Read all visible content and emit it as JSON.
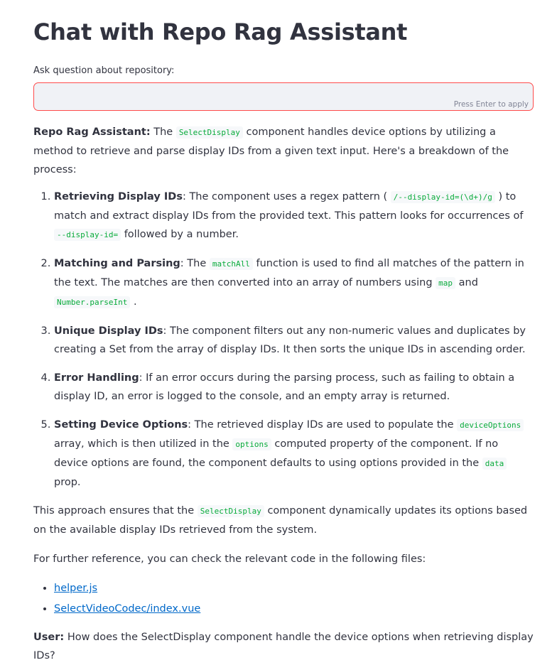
{
  "page": {
    "title": "Chat with Repo Rag Assistant"
  },
  "question_input": {
    "label": "Ask question about repository:",
    "value": "",
    "hint": "Press Enter to apply"
  },
  "answer": {
    "speaker": "Repo Rag Assistant:",
    "intro_pre": "The",
    "intro_code": "SelectDisplay",
    "intro_post": "component handles device options by utilizing a method to retrieve and parse display IDs from a given text input. Here's a breakdown of the process:",
    "steps": [
      {
        "title": "Retrieving Display IDs",
        "t1": ": The component uses a regex pattern (",
        "c1": "/--display-id=(\\d+)/g",
        "t2": ") to match and extract display IDs from the provided text. This pattern looks for occurrences of",
        "c2": "--display-id=",
        "t3": "followed by a number."
      },
      {
        "title": "Matching and Parsing",
        "t1": ": The",
        "c1": "matchAll",
        "t2": "function is used to find all matches of the pattern in the text. The matches are then converted into an array of numbers using",
        "c2": "map",
        "t3": "and",
        "c3": "Number.parseInt",
        "t4": "."
      },
      {
        "title": "Unique Display IDs",
        "t1": ": The component filters out any non-numeric values and duplicates by creating a Set from the array of display IDs. It then sorts the unique IDs in ascending order."
      },
      {
        "title": "Error Handling",
        "t1": ": If an error occurs during the parsing process, such as failing to obtain a display ID, an error is logged to the console, and an empty array is returned."
      },
      {
        "title": "Setting Device Options",
        "t1": ": The retrieved display IDs are used to populate the",
        "c1": "deviceOptions",
        "t2": "array, which is then utilized in the",
        "c2": "options",
        "t3": "computed property of the component. If no device options are found, the component defaults to using options provided in the",
        "c3": "data",
        "t4": "prop."
      }
    ],
    "conclusion_pre": "This approach ensures that the",
    "conclusion_code": "SelectDisplay",
    "conclusion_post": "component dynamically updates its options based on the available display IDs retrieved from the system.",
    "reference_text": "For further reference, you can check the relevant code in the following files:",
    "links": [
      "helper.js",
      "SelectVideoCodec/index.vue"
    ]
  },
  "user_message": {
    "speaker": "User:",
    "text": "How does the SelectDisplay component handle the device options when retrieving display IDs?"
  }
}
